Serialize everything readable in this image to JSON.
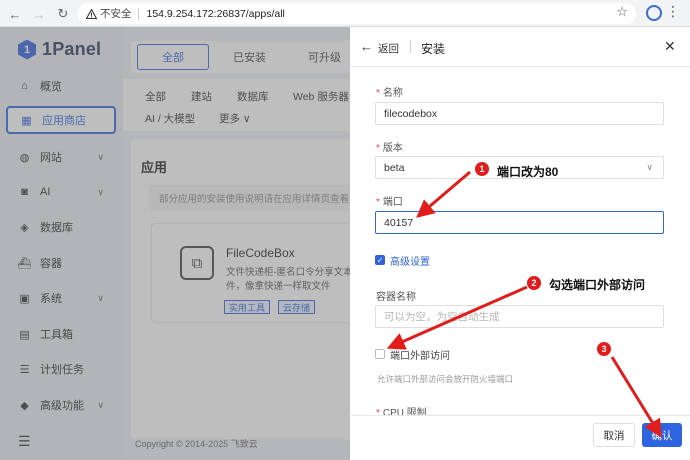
{
  "browser": {
    "security_label": "不安全",
    "url": "154.9.254.172:26837/apps/all"
  },
  "sidebar": {
    "logo": "1Panel",
    "items": [
      {
        "label": "概览",
        "icon": "home-icon"
      },
      {
        "label": "应用商店",
        "icon": "apps-grid-icon",
        "active": true
      },
      {
        "label": "网站",
        "icon": "globe-icon",
        "expandable": true
      },
      {
        "label": "AI",
        "icon": "robot-icon",
        "expandable": true
      },
      {
        "label": "数据库",
        "icon": "database-icon"
      },
      {
        "label": "容器",
        "icon": "container-icon"
      },
      {
        "label": "系统",
        "icon": "system-icon",
        "expandable": true
      },
      {
        "label": "工具箱",
        "icon": "toolbox-icon"
      },
      {
        "label": "计划任务",
        "icon": "task-icon"
      },
      {
        "label": "高级功能",
        "icon": "diamond-icon",
        "expandable": true
      }
    ],
    "menu_icon": "hamburger-icon"
  },
  "main": {
    "tabs": [
      "全部",
      "已安装",
      "可升级"
    ],
    "filters_row1": [
      "全部",
      "建站",
      "数据库",
      "Web 服务器"
    ],
    "filters_row2": [
      "AI / 大模型",
      "更多"
    ],
    "section_title": "应用",
    "notice": "部分应用的安装使用说明请在应用详情页查看",
    "card": {
      "name": "FileCodeBox",
      "desc_line1": "文件快递柜-匿名口令分享文本",
      "desc_line2": "件，像拿快递一样取文件",
      "tags": [
        "实用工具",
        "云存储"
      ]
    },
    "footer": "Copyright © 2014-2025 飞致云"
  },
  "drawer": {
    "back_label": "返回",
    "title": "安装",
    "fields": {
      "name_label": "名称",
      "name_value": "filecodebox",
      "version_label": "版本",
      "version_value": "beta",
      "port_label": "端口",
      "port_value": "40157",
      "advanced_label": "高级设置",
      "container_label": "容器名称",
      "container_placeholder": "可以为空，为空自动生成",
      "external_access_label": "端口外部访问",
      "external_access_hint": "允许端口外部访问会放开防火墙端口",
      "cpu_label": "CPU 限制"
    },
    "cancel_label": "取消",
    "confirm_label": "确认"
  },
  "annotations": [
    {
      "number": "1",
      "text": "端口改为80"
    },
    {
      "number": "2",
      "text": "勾选端口外部访问"
    },
    {
      "number": "3",
      "text": ""
    }
  ],
  "colors": {
    "accent": "#2f64e0",
    "annotation_red": "#e21b1b"
  }
}
